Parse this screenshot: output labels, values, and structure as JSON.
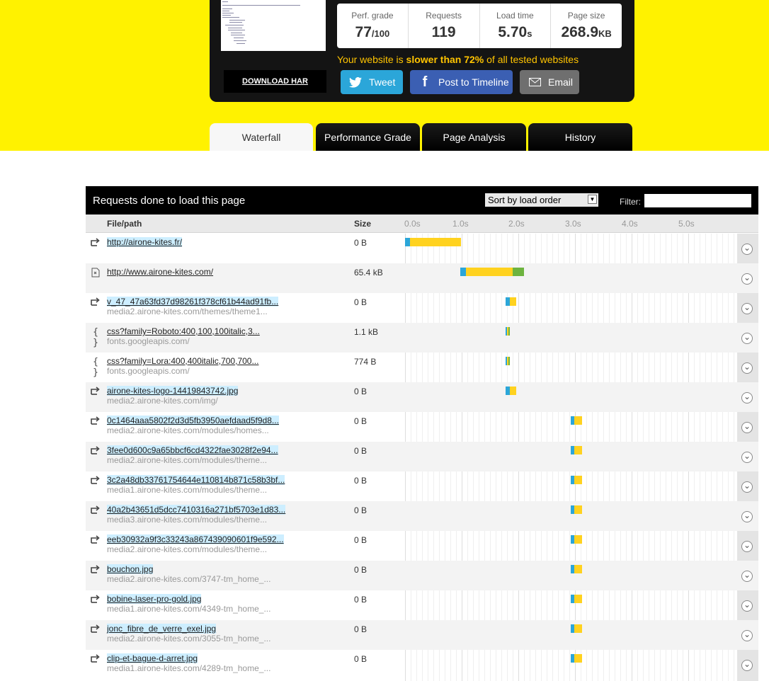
{
  "summary": {
    "download_har": "DOWNLOAD HAR",
    "stats": [
      {
        "label": "Perf. grade",
        "value": "77",
        "unit": "/100"
      },
      {
        "label": "Requests",
        "value": "119",
        "unit": ""
      },
      {
        "label": "Load time",
        "value": "5.70",
        "unit": "s"
      },
      {
        "label": "Page size",
        "value": "268.9",
        "unit": "KB"
      }
    ],
    "slower_prefix": "Your website is ",
    "slower_bold": "slower than 72%",
    "slower_suffix": " of all tested websites",
    "share": {
      "tweet": "Tweet",
      "facebook": "Post to Timeline",
      "email": "Email"
    }
  },
  "tabs": [
    "Waterfall",
    "Performance Grade",
    "Page Analysis",
    "History"
  ],
  "active_tab": "Waterfall",
  "requests_panel": {
    "title": "Requests done to load this page",
    "sort_value": "Sort by load order",
    "filter_label": "Filter:",
    "filter_value": ""
  },
  "columns": {
    "file": "File/path",
    "size": "Size",
    "ticks": [
      "0.0s",
      "1.0s",
      "2.0s",
      "3.0s",
      "4.0s",
      "5.0s"
    ]
  },
  "colors": {
    "yellow_bg": "#fff200",
    "dns": "#2ba6d9",
    "wait": "#ffd21f",
    "receive": "#6db33f",
    "connect": "#f39c12"
  },
  "rows": [
    {
      "icon": "redirect-icon",
      "name": "http://airone-kites.fr/",
      "host": "",
      "size": "0 B",
      "highlight": true,
      "timing": {
        "start": 0.0,
        "dns": 0.09,
        "wait": 0.9,
        "receive": 0.0
      }
    },
    {
      "icon": "document-icon",
      "name": "http://www.airone-kites.com/",
      "host": "",
      "size": "65.4 kB",
      "highlight": false,
      "timing": {
        "start": 0.98,
        "dns": 0.09,
        "wait": 0.83,
        "receive": 0.2
      }
    },
    {
      "icon": "redirect-icon",
      "name": "v_47_47a63fd37d98261f378cf61b44ad91fb...",
      "host": "media2.airone-kites.com/themes/theme1...",
      "size": "0 B",
      "highlight": true,
      "timing": {
        "start": 1.77,
        "dns": 0.08,
        "wait": 0.11,
        "receive": 0.0
      }
    },
    {
      "icon": "css-icon",
      "name": "css?family=Roboto:400,100,100italic,3...",
      "host": "fonts.googleapis.com/",
      "size": "1.1 kB",
      "highlight": false,
      "timing": {
        "start": 1.77,
        "dns": 0.03,
        "wait": 0.03,
        "receive": 0.02
      }
    },
    {
      "icon": "css-icon",
      "name": "css?family=Lora:400,400italic,700,700...",
      "host": "fonts.googleapis.com/",
      "size": "774 B",
      "highlight": false,
      "timing": {
        "start": 1.77,
        "dns": 0.03,
        "wait": 0.03,
        "receive": 0.02
      }
    },
    {
      "icon": "redirect-icon",
      "name": "airone-kites-logo-14419843742.jpg",
      "host": "media2.airone-kites.com/img/",
      "size": "0 B",
      "highlight": true,
      "timing": {
        "start": 1.77,
        "dns": 0.08,
        "wait": 0.11,
        "receive": 0.0
      }
    },
    {
      "icon": "redirect-icon",
      "name": "0c1464aaa5802f2d3d5fb3950aefdaad5f9d8...",
      "host": "media2.airone-kites.com/modules/homes...",
      "size": "0 B",
      "highlight": true,
      "timing": {
        "start": 2.93,
        "dns": 0.06,
        "wait": 0.13,
        "receive": 0.0
      }
    },
    {
      "icon": "redirect-icon",
      "name": "3fee0d600c9a65bbcf6cd4322fae3028f2e94...",
      "host": "media2.airone-kites.com/modules/theme...",
      "size": "0 B",
      "highlight": true,
      "timing": {
        "start": 2.93,
        "dns": 0.06,
        "wait": 0.13,
        "receive": 0.0
      }
    },
    {
      "icon": "redirect-icon",
      "name": "3c2a48db33761754644e110814b871c58b3bf...",
      "host": "media1.airone-kites.com/modules/theme...",
      "size": "0 B",
      "highlight": true,
      "timing": {
        "start": 2.93,
        "dns": 0.06,
        "wait": 0.13,
        "receive": 0.0
      }
    },
    {
      "icon": "redirect-icon",
      "name": "40a2b43651d5dcc7410316a271bf5703e1d83...",
      "host": "media3.airone-kites.com/modules/theme...",
      "size": "0 B",
      "highlight": true,
      "timing": {
        "start": 2.93,
        "dns": 0.06,
        "wait": 0.13,
        "receive": 0.0
      }
    },
    {
      "icon": "redirect-icon",
      "name": "eeb30932a9f3c33243a867439090601f9e592...",
      "host": "media2.airone-kites.com/modules/theme...",
      "size": "0 B",
      "highlight": true,
      "timing": {
        "start": 2.93,
        "dns": 0.06,
        "wait": 0.13,
        "receive": 0.0
      }
    },
    {
      "icon": "redirect-icon",
      "name": "bouchon.jpg",
      "host": "media2.airone-kites.com/3747-tm_home_...",
      "size": "0 B",
      "highlight": true,
      "timing": {
        "start": 2.93,
        "dns": 0.06,
        "wait": 0.13,
        "receive": 0.0
      }
    },
    {
      "icon": "redirect-icon",
      "name": "bobine-laser-pro-gold.jpg",
      "host": "media1.airone-kites.com/4349-tm_home_...",
      "size": "0 B",
      "highlight": true,
      "timing": {
        "start": 2.93,
        "dns": 0.06,
        "wait": 0.13,
        "receive": 0.0
      }
    },
    {
      "icon": "redirect-icon",
      "name": "jonc_fibre_de_verre_exel.jpg",
      "host": "media2.airone-kites.com/3055-tm_home_...",
      "size": "0 B",
      "highlight": true,
      "timing": {
        "start": 2.93,
        "dns": 0.06,
        "wait": 0.13,
        "receive": 0.0
      }
    },
    {
      "icon": "redirect-icon",
      "name": "clip-et-bague-d-arret.jpg",
      "host": "media1.airone-kites.com/4289-tm_home_...",
      "size": "0 B",
      "highlight": true,
      "timing": {
        "start": 2.93,
        "dns": 0.06,
        "wait": 0.13,
        "receive": 0.0
      }
    }
  ]
}
